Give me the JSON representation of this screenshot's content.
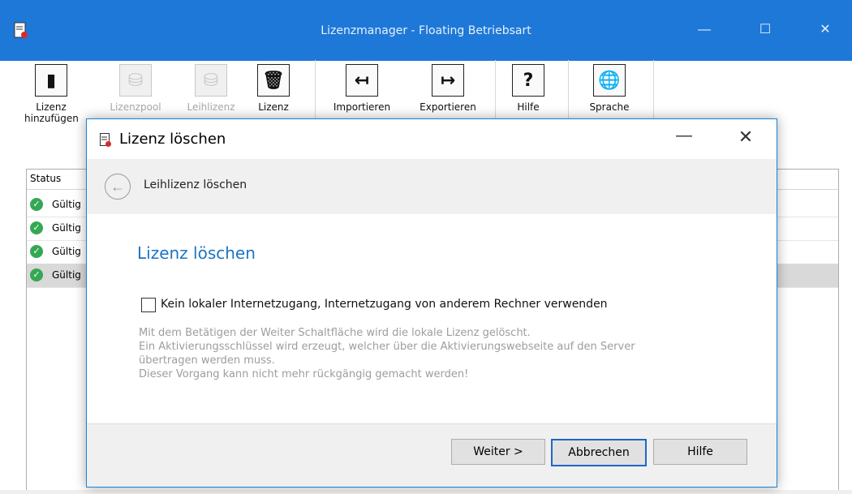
{
  "window": {
    "title": "Lizenzmanager - Floating Betriebsart",
    "minimize_glyph": "—",
    "maximize_glyph": "☐",
    "close_glyph": "✕"
  },
  "toolbar": {
    "buttons": [
      {
        "label": "Lizenz\nhinzufügen",
        "icon": "add-license-icon",
        "enabled": true
      },
      {
        "label": "Lizenzpool",
        "icon": "license-pool-icon",
        "enabled": false
      },
      {
        "label": "Leihlizenz",
        "icon": "borrow-license-icon",
        "enabled": false
      },
      {
        "label": "Lizenz",
        "icon": "delete-license-icon",
        "enabled": true
      },
      {
        "label": "Importieren",
        "icon": "import-icon",
        "enabled": true
      },
      {
        "label": "Exportieren",
        "icon": "export-icon",
        "enabled": true
      },
      {
        "label": "Hilfe",
        "icon": "help-icon",
        "enabled": true
      },
      {
        "label": "Sprache",
        "icon": "globe-icon",
        "enabled": true
      }
    ]
  },
  "license_list": {
    "header": "Status",
    "rows": [
      "Gültig",
      "Gültig",
      "Gültig",
      "Gültig"
    ]
  },
  "dialog": {
    "title": "Lizenz löschen",
    "minimize_glyph": "—",
    "close_glyph": "✕",
    "nav_title": "Leihlizenz löschen",
    "heading": "Lizenz löschen",
    "checkbox_label": "Kein lokaler Internetzugang, Internetzugang von anderem Rechner verwenden",
    "info_lines": [
      "Mit dem Betätigen der Weiter Schaltfläche wird die lokale Lizenz gelöscht.",
      "Ein Aktivierungsschlüssel wird erzeugt, welcher über die Aktivierungswebseite auf den Server",
      "übertragen werden muss.",
      "Dieser Vorgang kann nicht mehr rückgängig gemacht werden!"
    ],
    "buttons": {
      "next": "Weiter >",
      "cancel": "Abbrechen",
      "help": "Hilfe"
    }
  },
  "colors": {
    "titlebar": "#1e78d7",
    "heading": "#1e74c2"
  }
}
